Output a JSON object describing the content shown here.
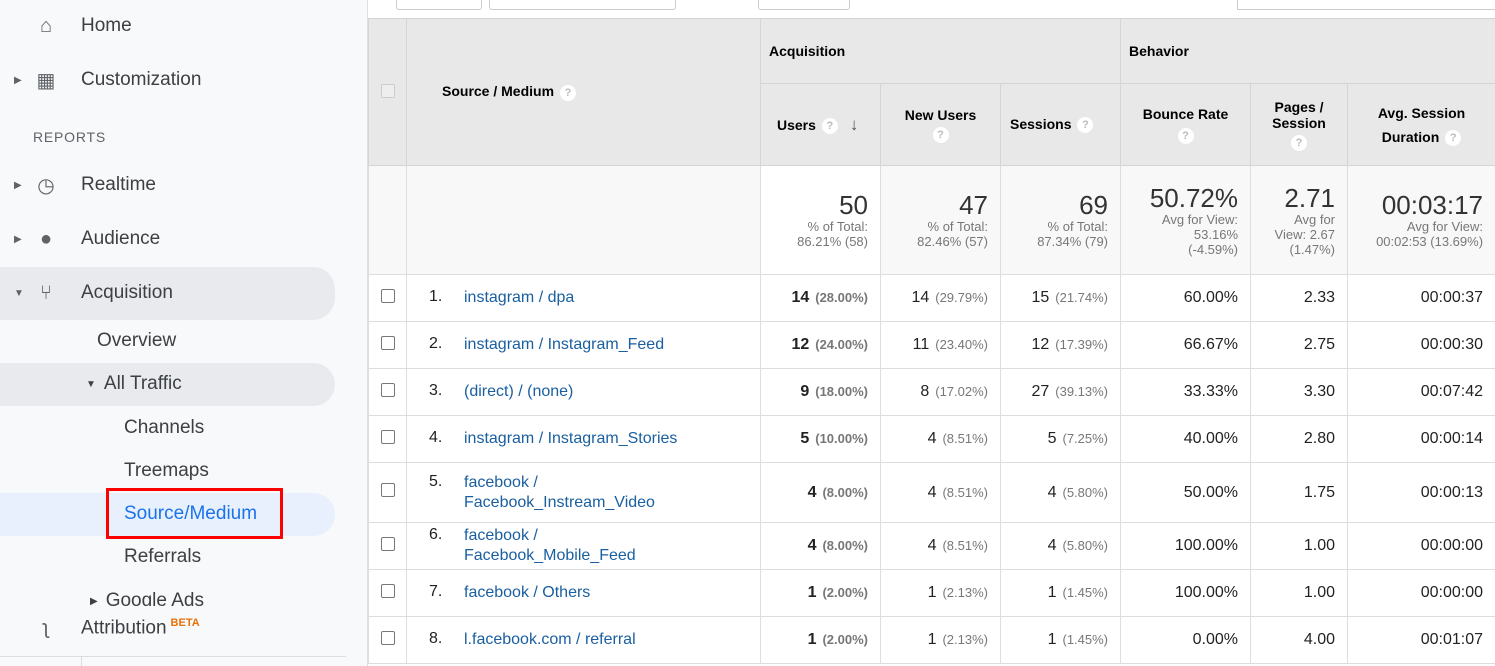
{
  "sidebar": {
    "home": "Home",
    "customization": "Customization",
    "reports_heading": "REPORTS",
    "realtime": "Realtime",
    "audience": "Audience",
    "acquisition": "Acquisition",
    "overview": "Overview",
    "all_traffic": "All Traffic",
    "channels": "Channels",
    "treemaps": "Treemaps",
    "source_medium": "Source/Medium",
    "referrals": "Referrals",
    "google_ads": "Google Ads",
    "attribution": "Attribution",
    "beta": "BETA",
    "highlight_color": "#ff0000",
    "active_color": "#1a73e8"
  },
  "table": {
    "source_header": "Source / Medium",
    "acquisition": "Acquisition",
    "behavior": "Behavior",
    "cols": [
      "Users",
      "New Users",
      "Sessions",
      "Bounce Rate",
      "Pages / Session",
      "Avg. Session Duration"
    ],
    "totals": [
      {
        "value": "50",
        "l1": "% of Total:",
        "l2": "86.21% (58)"
      },
      {
        "value": "47",
        "l1": "% of Total:",
        "l2": "82.46% (57)"
      },
      {
        "value": "69",
        "l1": "% of Total:",
        "l2": "87.34% (79)"
      },
      {
        "value": "50.72%",
        "l1": "Avg for View:",
        "l2": "53.16%",
        "l3": "(-4.59%)"
      },
      {
        "value": "2.71",
        "l1": "Avg for",
        "l2": "View: 2.67",
        "l3": "(1.47%)"
      },
      {
        "value": "00:03:17",
        "l1": "Avg for View:",
        "l2": "00:02:53 (13.69%)"
      }
    ],
    "rows": [
      {
        "n": "1.",
        "src": "instagram / dpa",
        "u": "14",
        "up": "(28.00%)",
        "nu": "14",
        "nup": "(29.79%)",
        "s": "15",
        "sp": "(21.74%)",
        "br": "60.00%",
        "ps": "2.33",
        "d": "00:00:37"
      },
      {
        "n": "2.",
        "src": "instagram / Instagram_Feed",
        "u": "12",
        "up": "(24.00%)",
        "nu": "11",
        "nup": "(23.40%)",
        "s": "12",
        "sp": "(17.39%)",
        "br": "66.67%",
        "ps": "2.75",
        "d": "00:00:30"
      },
      {
        "n": "3.",
        "src": "(direct) / (none)",
        "u": "9",
        "up": "(18.00%)",
        "nu": "8",
        "nup": "(17.02%)",
        "s": "27",
        "sp": "(39.13%)",
        "br": "33.33%",
        "ps": "3.30",
        "d": "00:07:42"
      },
      {
        "n": "4.",
        "src": "instagram / Instagram_Stories",
        "u": "5",
        "up": "(10.00%)",
        "nu": "4",
        "nup": "(8.51%)",
        "s": "5",
        "sp": "(7.25%)",
        "br": "40.00%",
        "ps": "2.80",
        "d": "00:00:14"
      },
      {
        "n": "5.",
        "src": "facebook / Facebook_Instream_Video",
        "u": "4",
        "up": "(8.00%)",
        "nu": "4",
        "nup": "(8.51%)",
        "s": "4",
        "sp": "(5.80%)",
        "br": "50.00%",
        "ps": "1.75",
        "d": "00:00:13"
      },
      {
        "n": "6.",
        "src": "facebook / Facebook_Mobile_Feed",
        "u": "4",
        "up": "(8.00%)",
        "nu": "4",
        "nup": "(8.51%)",
        "s": "4",
        "sp": "(5.80%)",
        "br": "100.00%",
        "ps": "1.00",
        "d": "00:00:00"
      },
      {
        "n": "7.",
        "src": "facebook / Others",
        "u": "1",
        "up": "(2.00%)",
        "nu": "1",
        "nup": "(2.13%)",
        "s": "1",
        "sp": "(1.45%)",
        "br": "100.00%",
        "ps": "1.00",
        "d": "00:00:00"
      },
      {
        "n": "8.",
        "src": "l.facebook.com / referral",
        "u": "1",
        "up": "(2.00%)",
        "nu": "1",
        "nup": "(2.13%)",
        "s": "1",
        "sp": "(1.45%)",
        "br": "0.00%",
        "ps": "4.00",
        "d": "00:01:07"
      }
    ]
  }
}
